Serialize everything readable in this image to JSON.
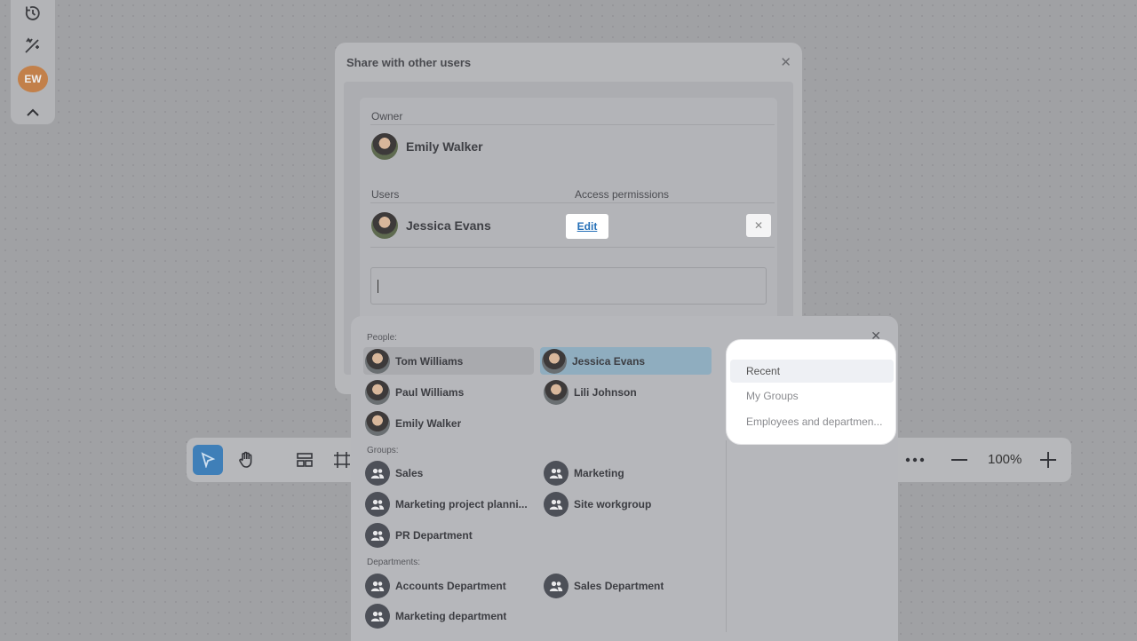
{
  "left_toolbar": {
    "avatar_initials": "EW",
    "icons": [
      "history-icon",
      "magic-wand-icon",
      "chevron-up-icon"
    ]
  },
  "bottom_toolbar": {
    "zoom_label": "100%",
    "icons": [
      "select-arrow-icon",
      "hand-icon",
      "layout-icon",
      "frame-icon",
      "more-icon",
      "zoom-out-icon",
      "zoom-in-icon"
    ]
  },
  "share_dialog": {
    "title": "Share with other users",
    "owner_label": "Owner",
    "owner_name": "Emily Walker",
    "users_label": "Users",
    "access_label": "Access permissions",
    "users": [
      {
        "name": "Jessica Evans",
        "permission": "Edit"
      }
    ],
    "search_value": ""
  },
  "picker": {
    "people_label": "People:",
    "people": [
      {
        "name": "Tom Williams",
        "state": "hover"
      },
      {
        "name": "Jessica Evans",
        "state": "selected"
      },
      {
        "name": "Paul Williams",
        "state": ""
      },
      {
        "name": "Lili Johnson",
        "state": ""
      },
      {
        "name": "Emily Walker",
        "state": ""
      }
    ],
    "groups_label": "Groups:",
    "groups": [
      "Sales",
      "Marketing",
      "Marketing project planni...",
      "Site workgroup",
      "PR Department"
    ],
    "departments_label": "Departments:",
    "departments": [
      "Accounts Department",
      "Sales Department",
      "Marketing department"
    ],
    "tabs": [
      {
        "label": "Recent",
        "active": true
      },
      {
        "label": "My Groups",
        "active": false
      },
      {
        "label": "Employees and departmen...",
        "active": false
      }
    ]
  },
  "colors": {
    "selected_item": "#8fadbf",
    "accent_blue": "#2670b8",
    "avatar_ew": "#c2804a"
  }
}
